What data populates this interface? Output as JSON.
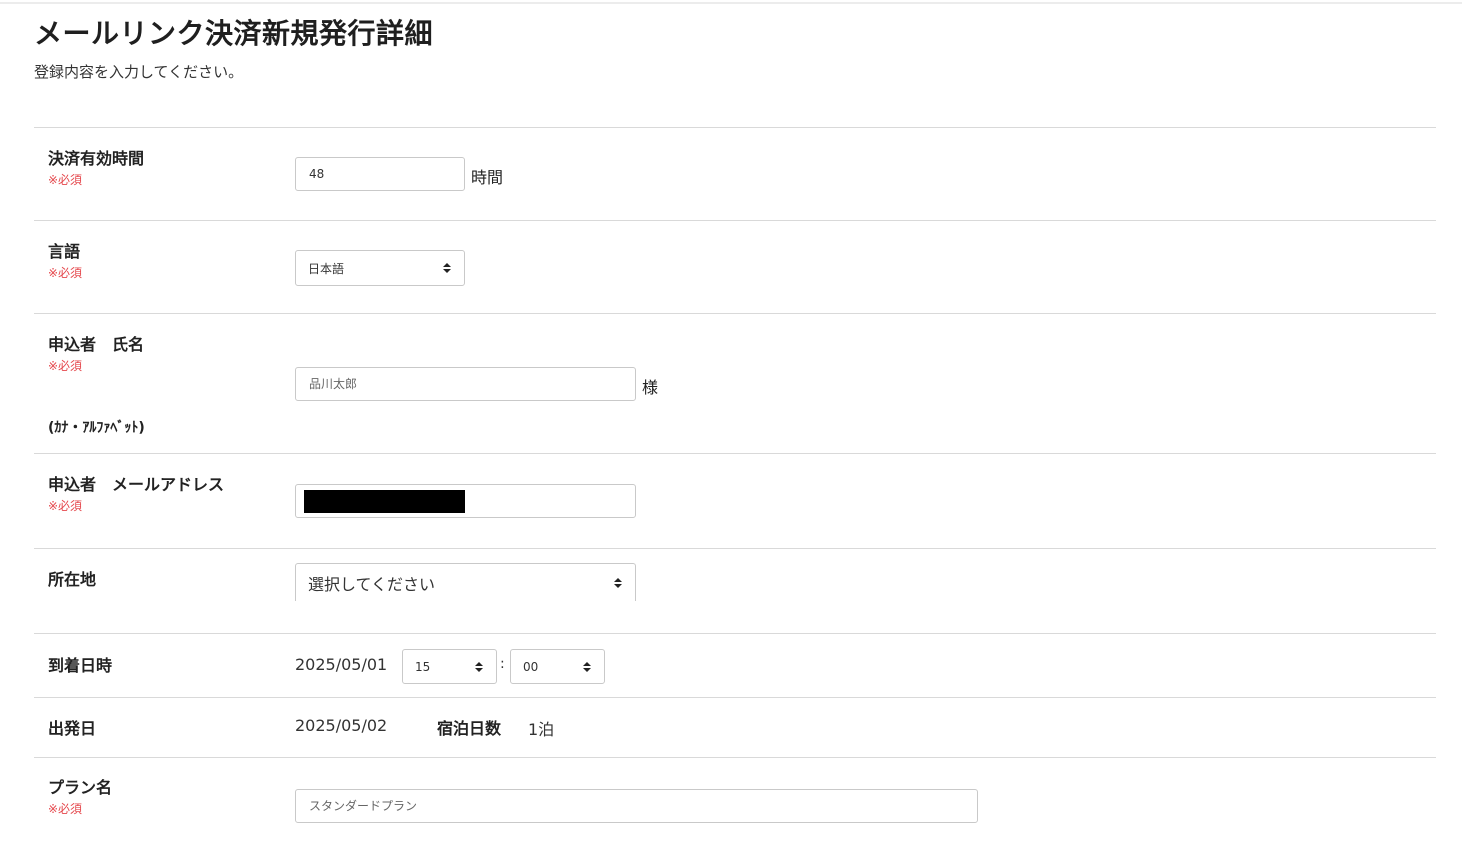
{
  "page": {
    "title": "メールリンク決済新規発行詳細",
    "subtitle": "登録内容を入力してください。"
  },
  "required_mark": "※必須",
  "fields": {
    "expiry": {
      "label": "決済有効時間",
      "value": "48",
      "unit": "時間"
    },
    "language": {
      "label": "言語",
      "selected": "日本語"
    },
    "applicant_name": {
      "label": "申込者　氏名",
      "placeholder": "品川太郎",
      "suffix": "様",
      "note": "(ｶﾅ・ｱﾙﾌｧﾍﾞｯﾄ)"
    },
    "applicant_email": {
      "label": "申込者　メールアドレス",
      "value": ""
    },
    "location": {
      "label": "所在地",
      "selected": "選択してください"
    },
    "arrival": {
      "label": "到着日時",
      "date": "2025/05/01",
      "hour": "15",
      "separator": ":",
      "minute": "00"
    },
    "departure": {
      "label": "出発日",
      "date": "2025/05/02",
      "nights_label": "宿泊日数",
      "nights_value": "1泊"
    },
    "plan": {
      "label": "プラン名",
      "placeholder": "スタンダードプラン"
    }
  },
  "colors": {
    "required": "#e5484d",
    "border": "#c9c9c9",
    "divider": "#d9d9d9"
  }
}
